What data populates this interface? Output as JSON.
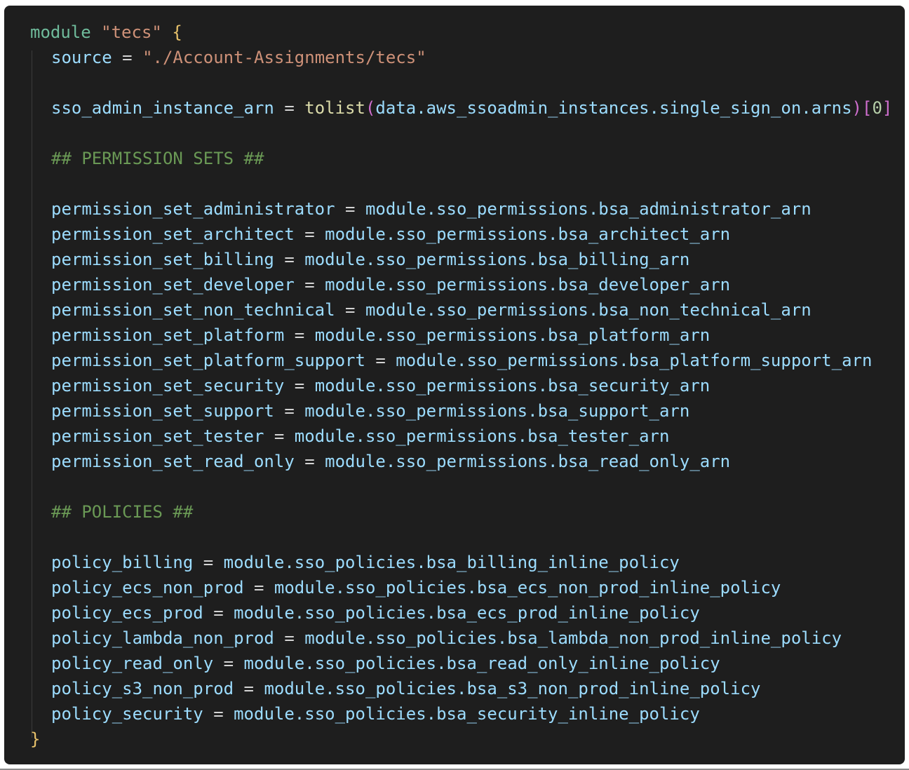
{
  "code": {
    "module_keyword": "module",
    "module_name": "\"tecs\"",
    "open_brace": "{",
    "close_brace": "}",
    "source_key": "source",
    "source_value": "\"./Account-Assignments/tecs\"",
    "sso_key": "sso_admin_instance_arn",
    "sso_fn": "tolist",
    "sso_open": "(",
    "sso_arg": "data.aws_ssoadmin_instances.single_sign_on.arns",
    "sso_close": ")",
    "sso_index_open": "[",
    "sso_index": "0",
    "sso_index_close": "]",
    "permission_comment": "## PERMISSION SETS ##",
    "permission_sets": [
      {
        "key": "permission_set_administrator",
        "value": "module.sso_permissions.bsa_administrator_arn"
      },
      {
        "key": "permission_set_architect",
        "value": "module.sso_permissions.bsa_architect_arn"
      },
      {
        "key": "permission_set_billing",
        "value": "module.sso_permissions.bsa_billing_arn"
      },
      {
        "key": "permission_set_developer",
        "value": "module.sso_permissions.bsa_developer_arn"
      },
      {
        "key": "permission_set_non_technical",
        "value": "module.sso_permissions.bsa_non_technical_arn"
      },
      {
        "key": "permission_set_platform",
        "value": "module.sso_permissions.bsa_platform_arn"
      },
      {
        "key": "permission_set_platform_support",
        "value": "module.sso_permissions.bsa_platform_support_arn"
      },
      {
        "key": "permission_set_security",
        "value": "module.sso_permissions.bsa_security_arn"
      },
      {
        "key": "permission_set_support",
        "value": "module.sso_permissions.bsa_support_arn"
      },
      {
        "key": "permission_set_tester",
        "value": "module.sso_permissions.bsa_tester_arn"
      },
      {
        "key": "permission_set_read_only",
        "value": "module.sso_permissions.bsa_read_only_arn"
      }
    ],
    "policies_comment": "## POLICIES ##",
    "policies": [
      {
        "key": "policy_billing",
        "value": "module.sso_policies.bsa_billing_inline_policy"
      },
      {
        "key": "policy_ecs_non_prod",
        "value": "module.sso_policies.bsa_ecs_non_prod_inline_policy"
      },
      {
        "key": "policy_ecs_prod",
        "value": "module.sso_policies.bsa_ecs_prod_inline_policy"
      },
      {
        "key": "policy_lambda_non_prod",
        "value": "module.sso_policies.bsa_lambda_non_prod_inline_policy"
      },
      {
        "key": "policy_read_only",
        "value": "module.sso_policies.bsa_read_only_inline_policy"
      },
      {
        "key": "policy_s3_non_prod",
        "value": "module.sso_policies.bsa_s3_non_prod_inline_policy"
      },
      {
        "key": "policy_security",
        "value": "module.sso_policies.bsa_security_inline_policy"
      }
    ],
    "equals": "="
  },
  "colors": {
    "background": "#1e1e1e",
    "keyword": "#6fbb9b",
    "string": "#ce9178",
    "brace": "#e8c26b",
    "identifier": "#9cdcfe",
    "function": "#dcdcaa",
    "bracket": "#d16fd0",
    "number": "#b5cea8",
    "comment": "#6a9955"
  }
}
